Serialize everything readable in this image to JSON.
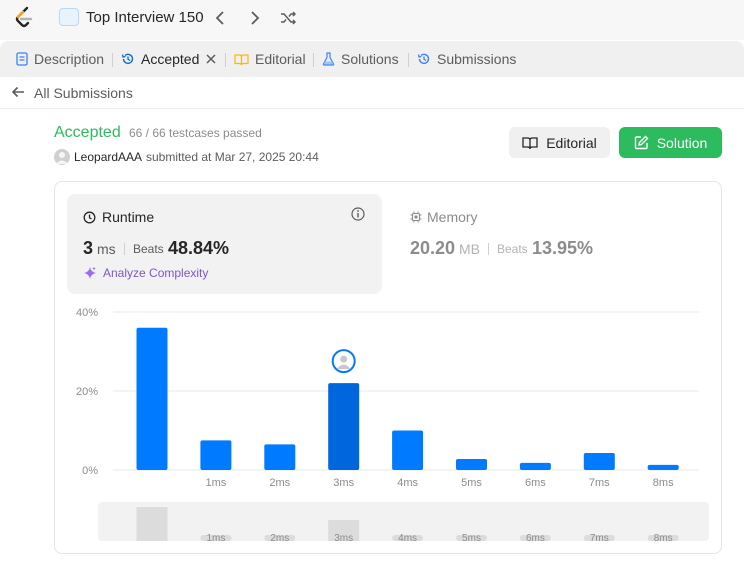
{
  "header": {
    "study_plan_title": "Top Interview 150"
  },
  "tabs": [
    {
      "label": "Description",
      "icon": "description-icon"
    },
    {
      "label": "Accepted",
      "icon": "history-icon",
      "active": true
    },
    {
      "label": "Editorial",
      "icon": "book-icon"
    },
    {
      "label": "Solutions",
      "icon": "flask-icon"
    },
    {
      "label": "Submissions",
      "icon": "history-icon"
    }
  ],
  "back_link": "All Submissions",
  "submission": {
    "status": "Accepted",
    "testcases": "66 / 66 testcases passed",
    "user": "LeopardAAA",
    "submitted_at": "submitted at Mar 27, 2025 20:44",
    "editorial_button": "Editorial",
    "solution_button": "Solution"
  },
  "runtime": {
    "label": "Runtime",
    "value": "3",
    "unit": "ms",
    "beats_label": "Beats",
    "beats_value": "48.84%",
    "analyze_label": "Analyze Complexity"
  },
  "memory": {
    "label": "Memory",
    "value": "20.20",
    "unit": "MB",
    "beats_label": "Beats",
    "beats_value": "13.95%"
  },
  "colors": {
    "accent_green": "#2cbb5d",
    "bar_blue": "#007aff",
    "bar_highlight": "#0066dd",
    "analyze_purple": "#7e57c2"
  },
  "chart_data": {
    "type": "bar",
    "categories": [
      "",
      "1ms",
      "2ms",
      "3ms",
      "4ms",
      "5ms",
      "6ms",
      "7ms",
      "8ms"
    ],
    "values": [
      36,
      7.5,
      6.5,
      22,
      10,
      2.8,
      1.8,
      4.3,
      1.3
    ],
    "highlight_index": 3,
    "y_ticks": [
      "0%",
      "20%",
      "40%"
    ],
    "ylim": [
      0,
      40
    ],
    "grid": true,
    "minimap": {
      "labels": [
        "",
        "1ms",
        "2ms",
        "3ms",
        "4ms",
        "5ms",
        "6ms",
        "7ms",
        "8ms"
      ]
    }
  }
}
